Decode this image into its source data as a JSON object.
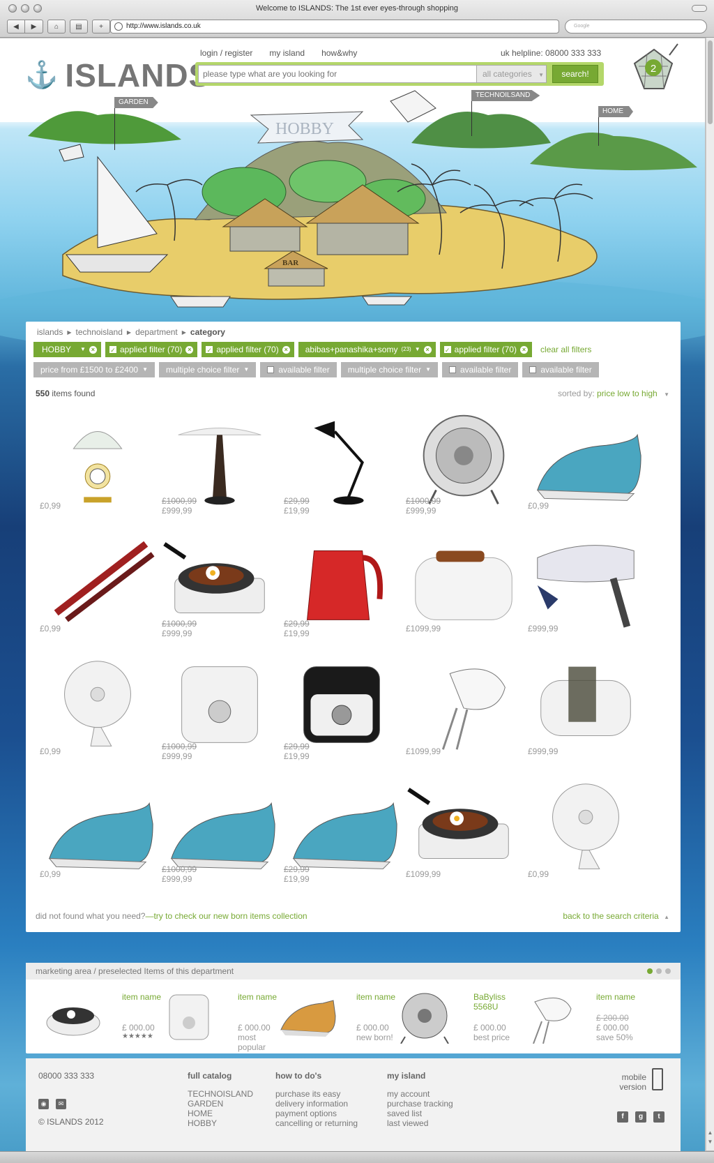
{
  "window": {
    "title": "Welcome to ISLANDS: The 1st ever eyes-through shopping",
    "url": "http://www.islands.co.uk",
    "search_placeholder": "Google"
  },
  "header": {
    "logo": "ISLANDS",
    "nav": [
      "login / register",
      "my island",
      "how&why"
    ],
    "helpline": "uk helpline: 08000 333 333",
    "search_placeholder": "please type what are you looking for",
    "category": "all categories",
    "search_button": "search!",
    "cart_count": "2"
  },
  "islands": {
    "garden": "GARDEN",
    "hobby": "HOBBY",
    "technoisland": "TECHNOILSAND",
    "home": "HOME",
    "bar": "BAR"
  },
  "breadcrumb": [
    "islands",
    "technoisland",
    "department",
    "category"
  ],
  "active_filters": {
    "hobby": "HOBBY",
    "applied1": "applied filter (70)",
    "applied2": "applied filter (70)",
    "brands": "abibas+panashika+somy",
    "brands_count": "(23)",
    "applied3": "applied filter (70)",
    "clear": "clear all filters"
  },
  "more_filters": {
    "price": "price from £1500 to £2400",
    "multi1": "multiple choice filter",
    "avail1": "available filter",
    "multi2": "multiple choice filter",
    "avail2": "available filter",
    "avail3": "available filter"
  },
  "results": {
    "count": "550",
    "count_label": "items found",
    "sort_label": "sorted by:",
    "sort_value": "price low to high"
  },
  "products": [
    {
      "old": "",
      "price": "£0,99"
    },
    {
      "old": "£1000,99",
      "price": "£999,99"
    },
    {
      "old": "£29,99",
      "price": "£19,99"
    },
    {
      "old": "£1000,99",
      "price": "£999,99"
    },
    {
      "old": "",
      "price": "£0,99"
    },
    {
      "old": "",
      "price": "£0,99"
    },
    {
      "old": "£1000,99",
      "price": "£999,99"
    },
    {
      "old": "£29,99",
      "price": "£19,99"
    },
    {
      "old": "",
      "price": "£1099,99"
    },
    {
      "old": "",
      "price": "£999,99"
    },
    {
      "old": "",
      "price": "£0,99"
    },
    {
      "old": "£1000,99",
      "price": "£999,99"
    },
    {
      "old": "£29,99",
      "price": "£19,99"
    },
    {
      "old": "",
      "price": "£1099,99"
    },
    {
      "old": "",
      "price": "£999,99"
    },
    {
      "old": "",
      "price": "£0,99"
    },
    {
      "old": "£1000,99",
      "price": "£999,99"
    },
    {
      "old": "£29,99",
      "price": "£19,99"
    },
    {
      "old": "",
      "price": "£1099,99"
    },
    {
      "old": "",
      "price": "£0,99"
    }
  ],
  "product_icons": [
    "table-lamp-icon",
    "desk-lamp-icon",
    "anglepoise-lamp-icon",
    "desk-fan-icon",
    "steam-iron-icon",
    "hair-straightener-icon",
    "hot-plate-icon",
    "kettle-icon",
    "toaster-icon",
    "hair-dryer-icon",
    "table-fan-icon",
    "deep-fryer-icon",
    "deep-fryer-black-icon",
    "hand-mixer-icon",
    "food-chopper-icon",
    "steam-iron-icon",
    "steam-iron-icon",
    "steam-iron-icon",
    "hot-plate-icon",
    "table-fan-icon"
  ],
  "bottom": {
    "notfound": "did not found what you need?",
    "notfound_link": "—try to check our new born items collection",
    "back": "back to the search criteria"
  },
  "marketing": {
    "title": "marketing area / preselected Items of this department",
    "items": [
      {
        "name": "item name",
        "old": "",
        "price": "£ 000.00",
        "tag": "★★★★★"
      },
      {
        "name": "item name",
        "old": "",
        "price": "£ 000.00",
        "tag": "most popular"
      },
      {
        "name": "item name",
        "old": "",
        "price": "£ 000.00",
        "tag": "new born!"
      },
      {
        "name": "BaByliss 5568U",
        "old": "",
        "price": "£ 000.00",
        "tag": "best price"
      },
      {
        "name": "item name",
        "old": "£ 200.00",
        "price": "£ 000.00",
        "tag": "save 50%"
      }
    ]
  },
  "footer": {
    "phone": "08000 333 333",
    "copyright": "© ISLANDS 2012",
    "catalog": {
      "title": "full catalog",
      "links": [
        "TECHNOISLAND",
        "GARDEN",
        "HOME",
        "HOBBY"
      ]
    },
    "howto": {
      "title": "how to do's",
      "links": [
        "purchase its easy",
        "delivery information",
        "payment options",
        "cancelling or returning"
      ]
    },
    "myisland": {
      "title": "my island",
      "links": [
        "my account",
        "purchase tracking",
        "saved list",
        "last viewed"
      ]
    },
    "mobile": "mobile version"
  },
  "colors": {
    "accent": "#77a933",
    "chip_grey": "#b5b5b5"
  }
}
